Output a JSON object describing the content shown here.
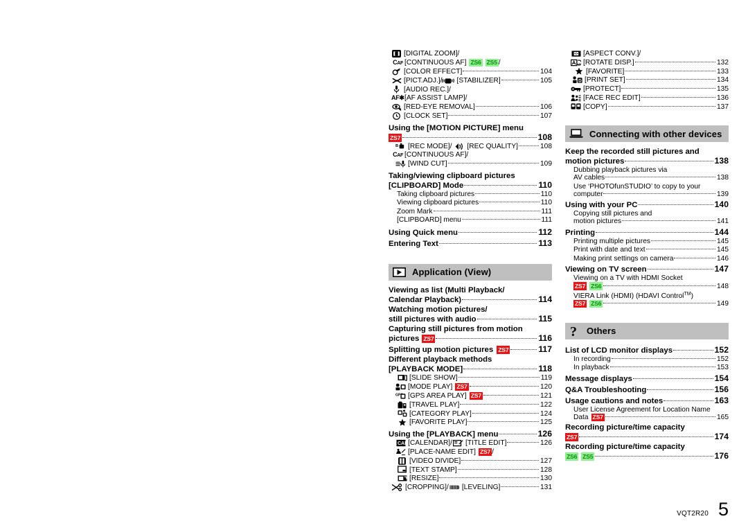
{
  "document": {
    "footer_code": "VQT2R20",
    "page_number": "5"
  },
  "badges": {
    "zs7": "ZS7",
    "zs6": "ZS6",
    "zs5": "ZS5",
    "colors": {
      "red_bg": "#ee1111",
      "red_fg": "#ffffff",
      "green_bg": "#8ef08e",
      "green_fg": "#0f8a0f",
      "band_bg": "#bfbfbf"
    }
  },
  "left_column": {
    "rec_menu_items": [
      {
        "icon": "digital-zoom-icon",
        "label": "[DIGITAL ZOOM]/",
        "page": ""
      },
      {
        "icon": "continuous-af-icon",
        "label": "[CONTINUOUS AF]",
        "badges": [
          "ZS6",
          "ZS5"
        ],
        "suffix": "/",
        "page": ""
      },
      {
        "icon": "color-effect-icon",
        "label": "[COLOR EFFECT]",
        "page": "104"
      },
      {
        "icon": "pict-adj-icon",
        "label": "[PICT.ADJ.]/",
        "icon2": "stabilizer-icon",
        "label2": "[STABILIZER]",
        "page": "105"
      },
      {
        "icon": "audio-rec-icon",
        "label": "[AUDIO REC.]/",
        "page": ""
      },
      {
        "icon": "af-assist-lamp-icon",
        "label": "[AF ASSIST LAMP]/",
        "page": ""
      },
      {
        "icon": "red-eye-removal-icon",
        "label": "[RED-EYE REMOVAL]",
        "page": "106"
      },
      {
        "icon": "clock-set-icon",
        "label": "[CLOCK SET]",
        "page": "107"
      }
    ],
    "motion_picture_heading": "Using the [MOTION PICTURE] menu",
    "motion_picture_page": "108",
    "motion_picture_items": [
      {
        "icon": "rec-mode-icon",
        "label": "[REC MODE]/",
        "icon2": "rec-quality-icon",
        "label2": "[REC QUALITY]",
        "page": "108"
      },
      {
        "icon": "continuous-af-icon",
        "label": "[CONTINUOUS AF]/",
        "page": ""
      },
      {
        "icon": "wind-cut-icon",
        "label": "[WIND CUT]",
        "page": "109"
      }
    ],
    "clipboard_heading_l1": "Taking/viewing clipboard pictures",
    "clipboard_heading_l2": "[CLIPBOARD] Mode",
    "clipboard_page": "110",
    "clipboard_items": [
      {
        "label": "Taking clipboard pictures",
        "page": "110"
      },
      {
        "label": "Viewing clipboard pictures",
        "page": "110"
      },
      {
        "label": "Zoom Mark",
        "page": "111"
      },
      {
        "label": "[CLIPBOARD] menu",
        "page": "111"
      }
    ],
    "quick_menu": {
      "label": "Using Quick menu",
      "page": "112"
    },
    "entering_text": {
      "label": "Entering Text",
      "page": "113"
    },
    "application_band": {
      "title": "Application (View)",
      "icon": "playback-triangle-icon"
    },
    "application_entries": [
      {
        "line1": "Viewing as list (Multi Playback/",
        "line2": "Calendar Playback)",
        "page": "114"
      },
      {
        "line1": "Watching motion pictures/",
        "line2": "still pictures with audio",
        "page": "115"
      },
      {
        "line1": "Capturing still pictures from motion",
        "line2": "pictures",
        "badges": [
          "ZS7"
        ],
        "page": "116"
      },
      {
        "line1": "",
        "line2": "Splitting up motion pictures",
        "badges": [
          "ZS7"
        ],
        "page": "117"
      },
      {
        "line1": "Different playback methods",
        "line2": "[PLAYBACK MODE]",
        "page": "118"
      }
    ],
    "playback_mode_items": [
      {
        "icon": "slide-show-icon",
        "label": "[SLIDE SHOW]",
        "page": "119"
      },
      {
        "icon": "mode-play-icon",
        "label": "[MODE PLAY]",
        "badges": [
          "ZS7"
        ],
        "page": "120"
      },
      {
        "icon": "gps-area-play-icon",
        "label": "[GPS AREA PLAY]",
        "badges": [
          "ZS7"
        ],
        "page": "121"
      },
      {
        "icon": "travel-play-icon",
        "label": "[TRAVEL PLAY]",
        "page": "122"
      },
      {
        "icon": "category-play-icon",
        "label": "[CATEGORY PLAY]",
        "page": "124"
      },
      {
        "icon": "favorite-play-icon",
        "label": "[FAVORITE PLAY]",
        "page": "125"
      }
    ],
    "playback_menu_heading": "Using the [PLAYBACK] menu",
    "playback_menu_page": "126",
    "playback_menu_items": [
      {
        "icon": "calendar-icon",
        "label": "[CALENDAR]/",
        "icon2": "title-edit-icon",
        "label2": "[TITLE EDIT]",
        "page": "126"
      },
      {
        "icon": "place-name-edit-icon",
        "label": "[PLACE-NAME EDIT]",
        "badges": [
          "ZS7"
        ],
        "suffix": "/",
        "page": ""
      },
      {
        "icon": "video-divide-icon",
        "label": "[VIDEO DIVIDE]",
        "page": "127"
      },
      {
        "icon": "text-stamp-icon",
        "label": "[TEXT STAMP]",
        "page": "128"
      },
      {
        "icon": "resize-icon",
        "label": "[RESIZE]",
        "page": "130"
      },
      {
        "icon": "cropping-icon",
        "label": "[CROPPING]/",
        "icon2": "leveling-icon",
        "label2": "[LEVELING]",
        "page": "131"
      }
    ]
  },
  "right_column": {
    "playback_menu_items_cont": [
      {
        "icon": "aspect-conv-icon",
        "label": "[ASPECT CONV.]/",
        "page": ""
      },
      {
        "icon": "rotate-disp-icon",
        "label": "[ROTATE DISP.]",
        "page": "132"
      },
      {
        "icon": "favorite-icon",
        "label": "[FAVORITE]",
        "page": "133"
      },
      {
        "icon": "print-set-icon",
        "label": "[PRINT SET]",
        "page": "134"
      },
      {
        "icon": "protect-icon",
        "label": "[PROTECT]",
        "page": "135"
      },
      {
        "icon": "face-rec-edit-icon",
        "label": "[FACE REC EDIT]",
        "page": "136"
      },
      {
        "icon": "copy-icon",
        "label": "[COPY]",
        "page": "137"
      }
    ],
    "connecting_band": {
      "title": "Connecting with other devices",
      "icon": "laptop-icon"
    },
    "keep_recorded": {
      "line1": "Keep the recorded still pictures and",
      "line2": "motion pictures",
      "page": "138",
      "subs": [
        {
          "line1": "Dubbing playback pictures via",
          "line2": "AV cables",
          "page": "138"
        },
        {
          "line1": "Use ‘PHOTOfunSTUDIO’ to copy to your",
          "line2": "computer",
          "page": "139"
        }
      ]
    },
    "using_pc": {
      "label": "Using with your PC",
      "page": "140",
      "subs": [
        {
          "line1": "Copying still pictures and",
          "line2": "motion pictures",
          "page": "141"
        }
      ]
    },
    "printing": {
      "label": "Printing",
      "page": "144",
      "subs": [
        {
          "label": "Printing multiple pictures",
          "page": "145"
        },
        {
          "label": "Print with date and text",
          "page": "145"
        },
        {
          "label": "Making print settings on camera",
          "page": "146"
        }
      ]
    },
    "viewing_tv": {
      "label": "Viewing on TV screen",
      "page": "147",
      "subs": [
        {
          "line1": "Viewing on a TV with HDMI Socket",
          "badges": [
            "ZS7",
            "ZS6"
          ],
          "page": "148"
        },
        {
          "line1": "VIERA Link (HDMI) (HDAVI Control",
          "tm": "TM",
          "line1_suffix": ")",
          "badges": [
            "ZS7",
            "ZS6"
          ],
          "page": "149"
        }
      ]
    },
    "others_band": {
      "title": "Others",
      "icon": "question-mark-icon"
    },
    "others_entries": [
      {
        "label": "List of LCD monitor displays",
        "page": "152",
        "subs": [
          {
            "label": "In recording",
            "page": "152"
          },
          {
            "label": "In playback",
            "page": "153"
          }
        ]
      },
      {
        "label": "Message displays",
        "page": "154",
        "subs": []
      },
      {
        "label": "Q&A  Troubleshooting",
        "page": "156",
        "subs": []
      },
      {
        "label": "Usage cautions and notes",
        "page": "163",
        "subs": [
          {
            "line1": "User License Agreement for Location Name",
            "line2": "Data",
            "badges": [
              "ZS7"
            ],
            "page": "165"
          }
        ]
      }
    ],
    "capacity_1": {
      "line1": "Recording picture/time capacity",
      "badges": [
        "ZS7"
      ],
      "page": "174"
    },
    "capacity_2": {
      "line1": "Recording picture/time capacity",
      "badges": [
        "ZS6",
        "ZS5"
      ],
      "page": "176"
    }
  }
}
